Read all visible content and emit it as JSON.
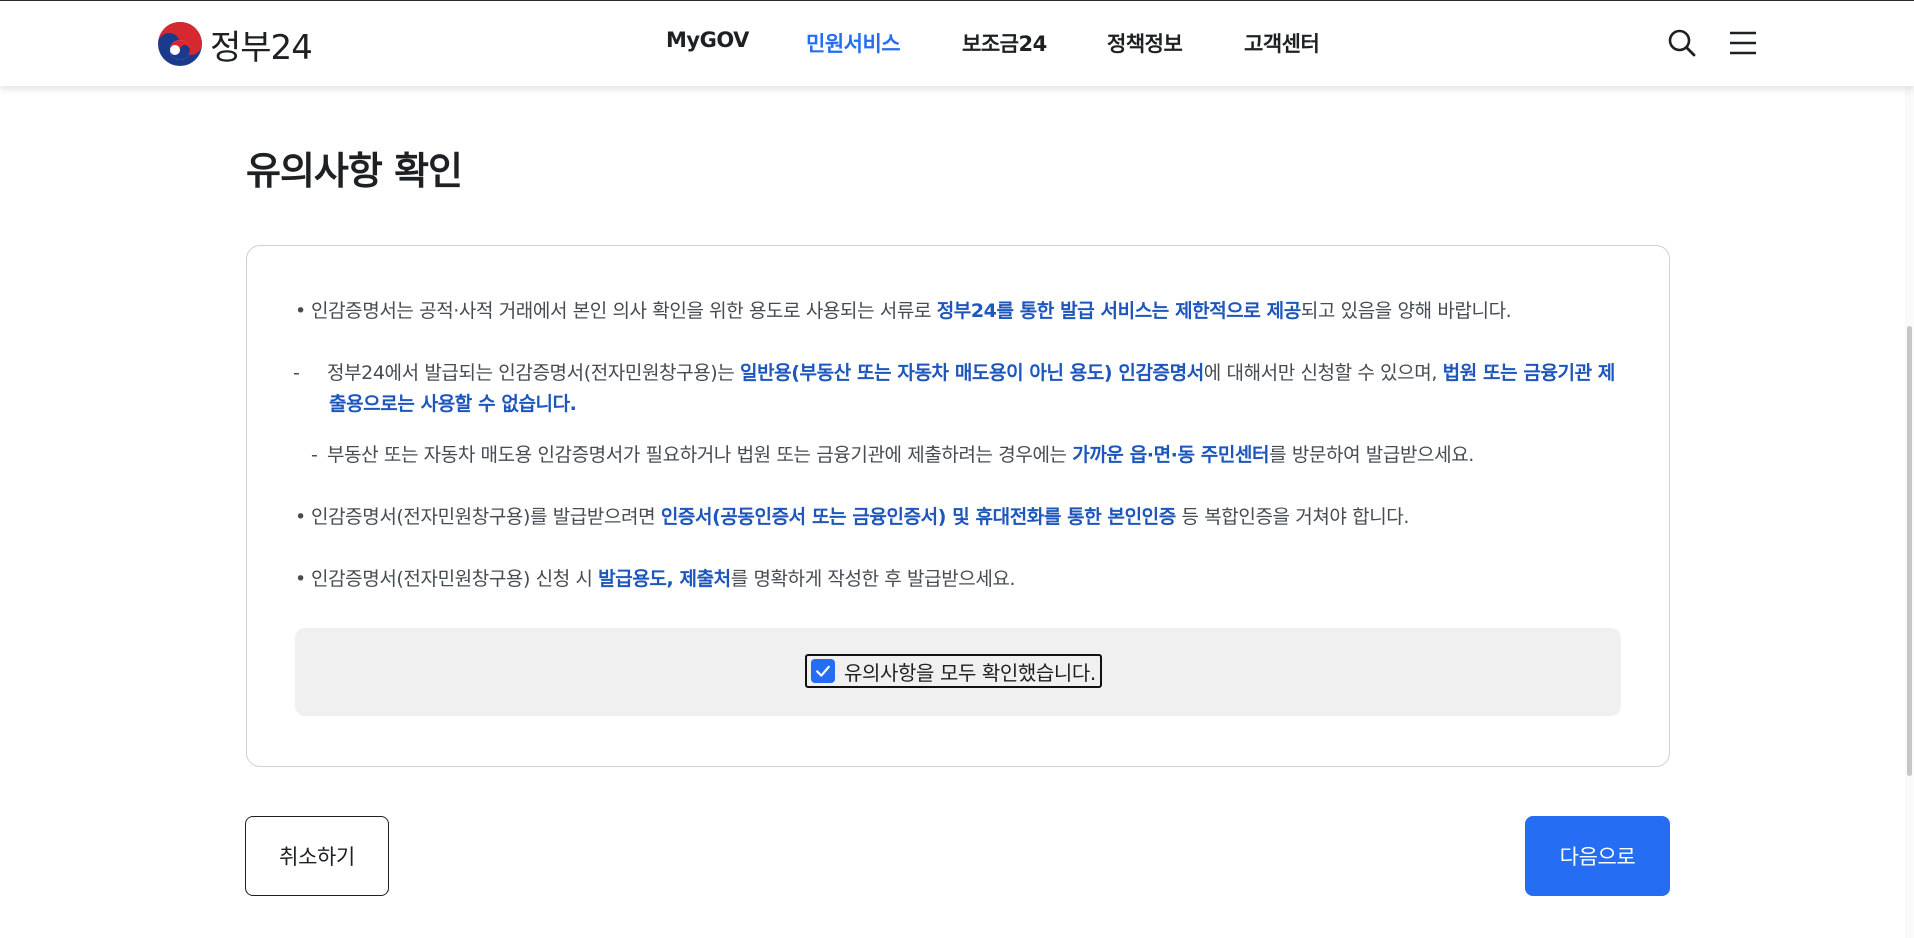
{
  "header": {
    "logo_text": "정부24",
    "nav": [
      {
        "label": "MyGOV",
        "active": false
      },
      {
        "label": "민원서비스",
        "active": true
      },
      {
        "label": "보조금24",
        "active": false
      },
      {
        "label": "정책정보",
        "active": false
      },
      {
        "label": "고객센터",
        "active": false
      }
    ],
    "search_icon": "search-icon",
    "menu_icon": "hamburger-menu-icon"
  },
  "page": {
    "title": "유의사항 확인"
  },
  "notices": {
    "item1": {
      "text_a": "인감증명서는 공적·사적 거래에서 본인 의사 확인을 위한 용도로 사용되는 서류로 ",
      "em_a": "정부24를 통한 발급 서비스는 제한적으로 제공",
      "text_b": "되고 있음을 양해 바랍니다."
    },
    "item2": {
      "text_a": "정부24에서 발급되는 인감증명서(전자민원창구용)는 ",
      "em_a": "일반용(부동산 또는 자동차 매도용이 아닌 용도) 인감증명서",
      "text_b": "에 대해서만 신청할 수 있으며, ",
      "em_b": "법원 또는 금융기관 제출용으로는 사용할 수 없습니다."
    },
    "item3": {
      "text_a": "부동산 또는 자동차 매도용 인감증명서가 필요하거나 법원 또는 금융기관에 제출하려는 경우에는 ",
      "em_a": "가까운 읍·면·동 주민센터",
      "text_b": "를 방문하여 발급받으세요."
    },
    "item4": {
      "text_a": "인감증명서(전자민원창구용)를 발급받으려면 ",
      "em_a": "인증서(공동인증서 또는 금융인증서) 및 휴대전화를 통한 본인인증",
      "text_b": " 등 복합인증을 거쳐야 합니다."
    },
    "item5": {
      "text_a": "인감증명서(전자민원창구용) 신청 시 ",
      "em_a": "발급용도, 제출처",
      "text_b": "를 명확하게 작성한 후 발급받으세요."
    },
    "bullet": "•",
    "dash": "-"
  },
  "confirm": {
    "label": "유의사항을 모두 확인했습니다.",
    "checked": true
  },
  "buttons": {
    "cancel": "취소하기",
    "next": "다음으로"
  },
  "colors": {
    "accent": "#256ef4",
    "emphasis": "#1d56bc",
    "text": "#1e2124"
  }
}
